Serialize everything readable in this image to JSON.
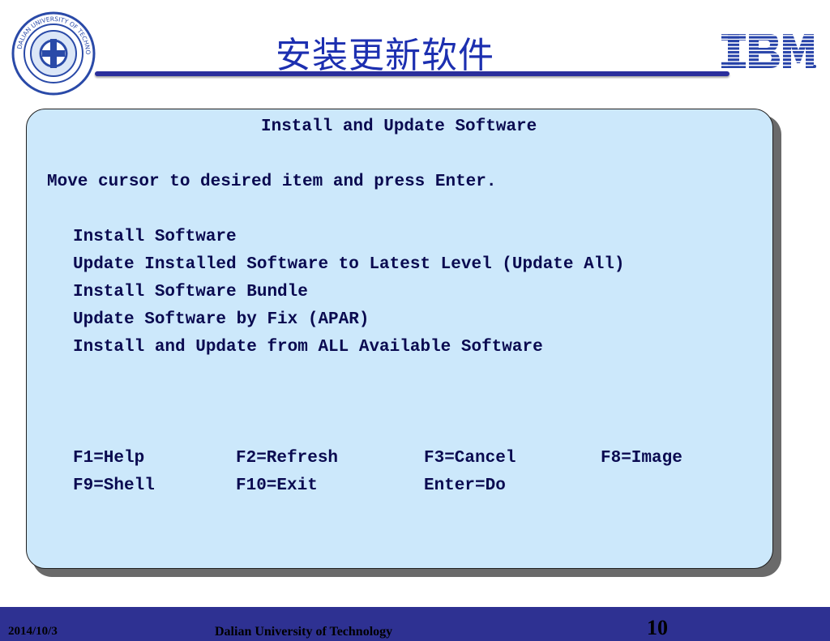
{
  "header": {
    "title": "安装更新软件",
    "logo_text": "DALIAN UNIVERSITY OF TECHNOLOGY",
    "brand_accent": "#2e3192"
  },
  "screen": {
    "heading": "Install and Update Software",
    "instruction": "Move cursor to desired item and press Enter.",
    "menu_items": [
      "Install Software",
      "Update Installed Software to Latest Level (Update All)",
      "Install Software Bundle",
      "Update Software by Fix (APAR)",
      "Install and Update from ALL Available Software"
    ],
    "function_keys": [
      "F1=Help",
      "F2=Refresh",
      "F3=Cancel",
      "F8=Image",
      "F9=Shell",
      "F10=Exit",
      "Enter=Do"
    ],
    "panel_color": "#cce8fb"
  },
  "footer": {
    "date": "2014/10/3",
    "university": "Dalian University of Technology",
    "page_number": "10"
  }
}
